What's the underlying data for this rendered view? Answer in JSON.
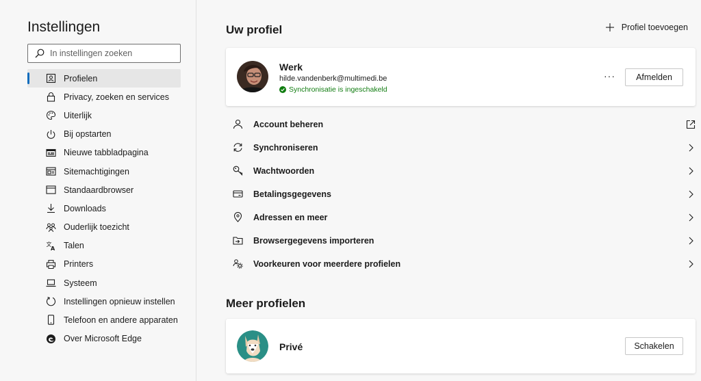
{
  "sidebar": {
    "title": "Instellingen",
    "search_placeholder": "In instellingen zoeken",
    "items": [
      {
        "label": "Profielen",
        "icon": "profile-card-icon",
        "active": true
      },
      {
        "label": "Privacy, zoeken en services",
        "icon": "lock-icon"
      },
      {
        "label": "Uiterlijk",
        "icon": "palette-icon"
      },
      {
        "label": "Bij opstarten",
        "icon": "power-icon"
      },
      {
        "label": "Nieuwe tabbladpagina",
        "icon": "newtab-icon"
      },
      {
        "label": "Sitemachtigingen",
        "icon": "site-permissions-icon"
      },
      {
        "label": "Standaardbrowser",
        "icon": "browser-window-icon"
      },
      {
        "label": "Downloads",
        "icon": "download-icon"
      },
      {
        "label": "Ouderlijk toezicht",
        "icon": "family-icon"
      },
      {
        "label": "Talen",
        "icon": "language-icon"
      },
      {
        "label": "Printers",
        "icon": "printer-icon"
      },
      {
        "label": "Systeem",
        "icon": "laptop-icon"
      },
      {
        "label": "Instellingen opnieuw instellen",
        "icon": "reset-icon"
      },
      {
        "label": "Telefoon en andere apparaten",
        "icon": "phone-icon"
      },
      {
        "label": "Over Microsoft Edge",
        "icon": "edge-logo-icon"
      }
    ]
  },
  "main": {
    "profile_section_title": "Uw profiel",
    "add_profile_label": "Profiel toevoegen",
    "current_profile": {
      "name": "Werk",
      "email": "hilde.vandenberk@multimedi.be",
      "sync_status": "Synchronisatie is ingeschakeld",
      "more_label": "···",
      "logout_label": "Afmelden"
    },
    "rows": [
      {
        "label": "Account beheren",
        "icon": "person-icon",
        "end": "external-link-icon"
      },
      {
        "label": "Synchroniseren",
        "icon": "sync-icon",
        "end": "chevron-right-icon"
      },
      {
        "label": "Wachtwoorden",
        "icon": "key-icon",
        "end": "chevron-right-icon"
      },
      {
        "label": "Betalingsgegevens",
        "icon": "credit-card-icon",
        "end": "chevron-right-icon"
      },
      {
        "label": "Adressen en meer",
        "icon": "location-pin-icon",
        "end": "chevron-right-icon"
      },
      {
        "label": "Browsergegevens importeren",
        "icon": "import-folder-icon",
        "end": "chevron-right-icon"
      },
      {
        "label": "Voorkeuren voor meerdere profielen",
        "icon": "profiles-settings-icon",
        "end": "chevron-right-icon"
      }
    ],
    "more_profiles_title": "Meer profielen",
    "other_profile": {
      "name": "Privé",
      "switch_label": "Schakelen"
    }
  },
  "colors": {
    "accent": "#0f6cbd",
    "sync_green": "#107c10",
    "prive_avatar_bg": "#2a8f86"
  }
}
